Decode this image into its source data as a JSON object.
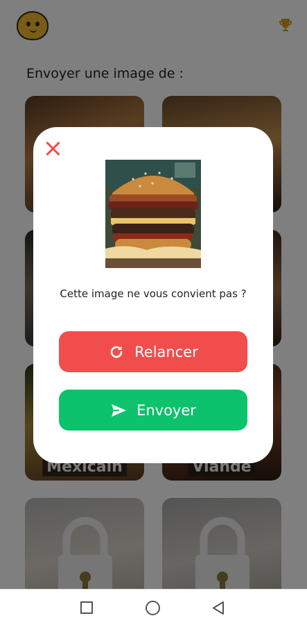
{
  "header": {
    "avatar_icon": "angry-mascot-avatar-icon",
    "trophy_icon": "trophy-icon"
  },
  "main": {
    "section_title": "Envoyer une image de :",
    "cards": [
      {
        "label": ""
      },
      {
        "label": ""
      },
      {
        "label": ""
      },
      {
        "label": ""
      },
      {
        "label": "Mexicain"
      },
      {
        "label": "Viande"
      },
      {
        "label": "",
        "locked": true
      },
      {
        "label": "",
        "locked": true
      }
    ]
  },
  "modal": {
    "close_icon": "close-icon",
    "image_subject": "burger-photo",
    "message": "Cette image ne vous convient pas ?",
    "relaunch_label": "Relancer",
    "relaunch_icon": "refresh-icon",
    "send_label": "Envoyer",
    "send_icon": "send-icon"
  },
  "navbar": {
    "items": [
      "recents-square-icon",
      "home-circle-icon",
      "back-triangle-icon"
    ]
  },
  "colors": {
    "accent_red": "#f24d4d",
    "accent_green": "#0dc26c",
    "trophy": "#d99a1c",
    "avatar": "#f5b82e"
  }
}
